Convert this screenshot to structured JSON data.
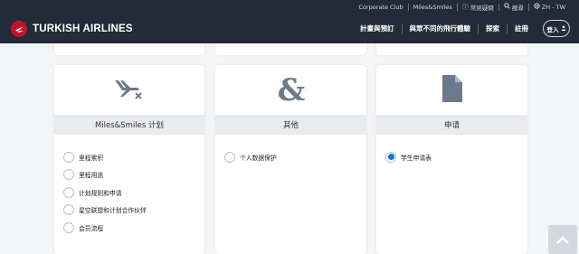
{
  "topbar": {
    "corporate_club": "Corporate Club",
    "miles_smiles": "Miles&Smiles",
    "help": "常見疑問",
    "search": "搜尋",
    "language": "ZH - TW",
    "help_icon": "info-icon",
    "search_icon": "search-icon",
    "language_icon": "globe-icon"
  },
  "header": {
    "brand": "TURKISH AIRLINES",
    "nav": [
      "計畫與預訂",
      "與眾不同的飛行體驗",
      "探索",
      "註冊"
    ],
    "login_label": "登入",
    "login_icon": "user-icon"
  },
  "cards": [
    {
      "title": "Miles&Smiles 计划",
      "icon": "plane-cancel-icon",
      "options": [
        "里程累积",
        "里程用途",
        "计划规则和申请",
        "星空联盟和计划合作伙伴",
        "会员流程"
      ],
      "selected": -1
    },
    {
      "title": "其他",
      "icon": "ampersand-icon",
      "options": [
        "个人数据保护"
      ],
      "selected": -1
    },
    {
      "title": "申请",
      "icon": "document-icon",
      "options": [
        "学生申请表"
      ],
      "selected": 0
    }
  ],
  "back_to_top_icon": "chevron-up-icon",
  "colors": {
    "header_bg": "#232b38",
    "brand_red": "#c8102e",
    "radio_selected": "#1a6fe0",
    "category_bar": "#e9ebef",
    "icon_color": "#6d7a8c"
  }
}
